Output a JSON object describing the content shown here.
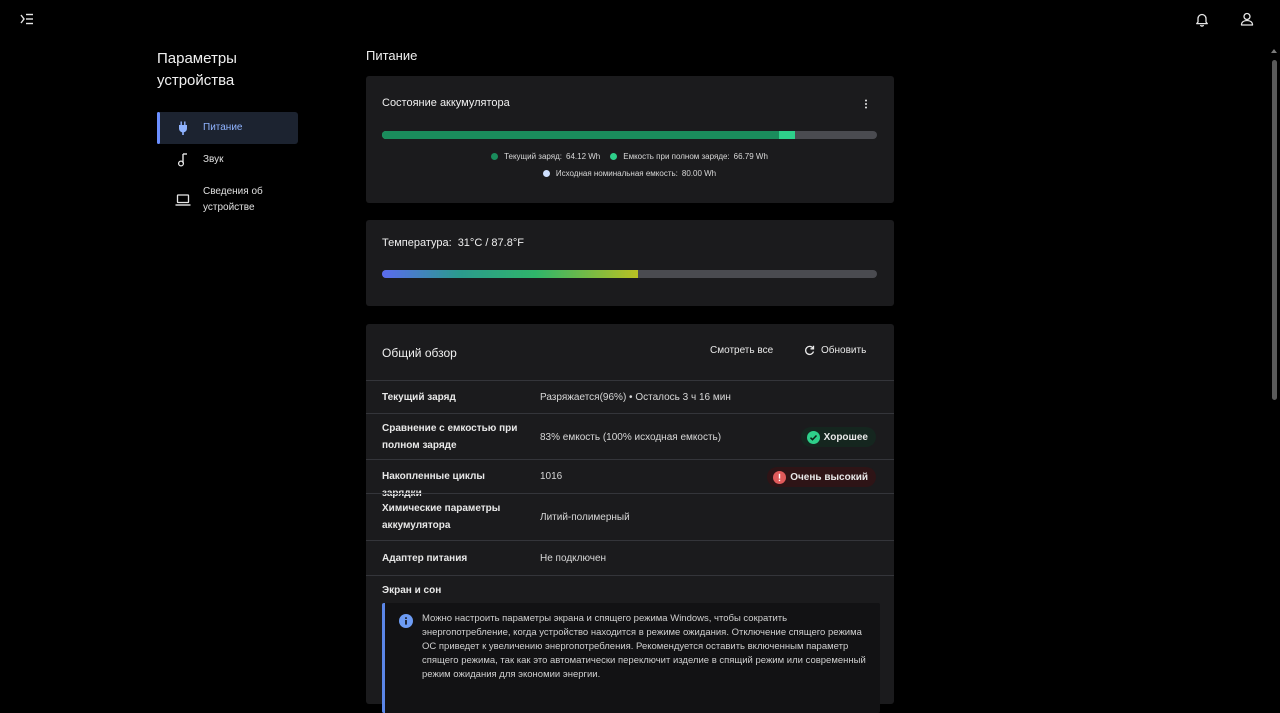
{
  "topbar": {
    "menu_icon": "menu-collapse-icon",
    "bell_icon": "bell-icon",
    "user_icon": "user-icon"
  },
  "sidebar": {
    "title_line1": "Параметры",
    "title_line2": "устройства",
    "items": [
      {
        "label": "Питание",
        "icon": "plug-icon",
        "active": true
      },
      {
        "label": "Звук",
        "icon": "music-note-icon",
        "active": false
      },
      {
        "label_line1": "Сведения об",
        "label_line2": "устройстве",
        "icon": "laptop-icon",
        "active": false
      }
    ]
  },
  "main": {
    "title": "Питание",
    "battery": {
      "title": "Состояние аккумулятора",
      "current_fraction": 0.802,
      "full_fraction": 0.835,
      "legend": {
        "current_label": "Текущий заряд:",
        "current_value": "64.12 Wh",
        "full_label": "Емкость при полном заряде:",
        "full_value": "66.79 Wh",
        "design_label": "Исходная номинальная емкость:",
        "design_value": "80.00 Wh"
      },
      "colors": {
        "current": "#1a8c5c",
        "full": "#2ecf8a",
        "design": "#cfe0ff",
        "track": "#4a4b50"
      }
    },
    "temperature": {
      "label": "Температура:",
      "value": "31°C / 87.8°F",
      "fraction": 0.517
    },
    "overview": {
      "title": "Общий обзор",
      "view_all": "Смотреть все",
      "refresh": "Обновить",
      "rows": {
        "current_charge": {
          "label": "Текущий заряд",
          "value": "Разряжается(96%)  •  Осталось 3 ч 16 мин"
        },
        "capacity_compare": {
          "label": "Сравнение с емкостью при полном заряде",
          "value": "83% емкость (100% исходная емкость)",
          "badge": "Хорошее"
        },
        "cycles": {
          "label": "Накопленные циклы зарядки",
          "value": "1016",
          "badge": "Очень высокий"
        },
        "chemistry": {
          "label": "Химические параметры аккумулятора",
          "value": "Литий-полимерный"
        },
        "adapter": {
          "label": "Адаптер питания",
          "value": "Не подключен"
        }
      },
      "screen_section": "Экран и сон",
      "info_text": "Можно настроить параметры экрана и спящего режима Windows, чтобы сократить энергопотребление, когда устройство находится в режиме ожидания. Отключение спящего режима ОС приведет к увеличению энергопотребления. Рекомендуется оставить включенным параметр спящего режима, так как это автоматически переключит изделие в спящий режим или современный режим ожидания для экономии энергии."
    }
  }
}
